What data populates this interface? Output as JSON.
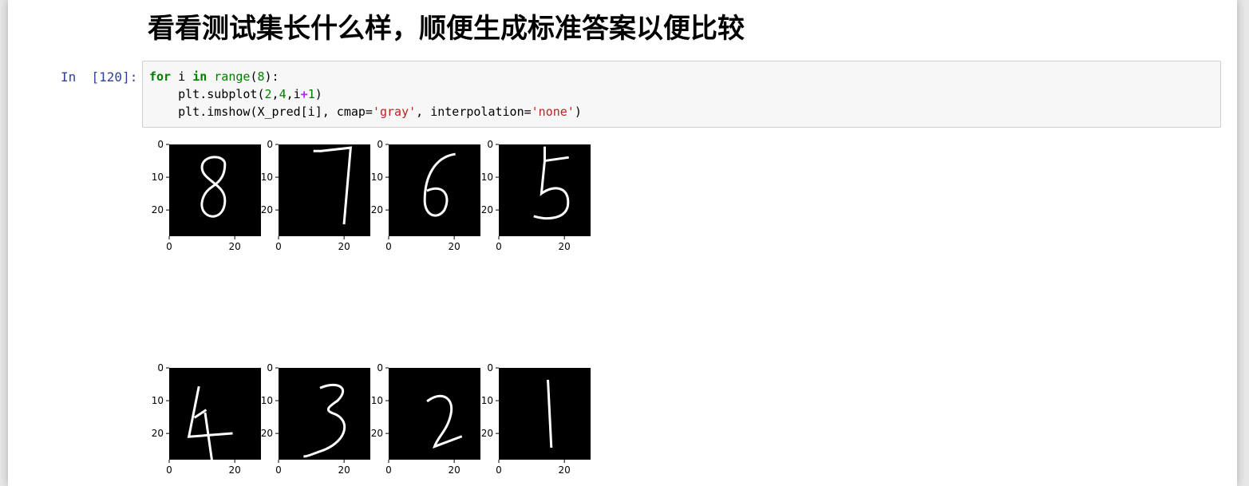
{
  "heading": "看看测试集长什么样，顺便生成标准答案以便比较",
  "cell": {
    "prompt": "In  [120]:",
    "code": [
      [
        [
          "kw",
          "for"
        ],
        [
          "p",
          " i "
        ],
        [
          "kw",
          "in"
        ],
        [
          "p",
          " "
        ],
        [
          "bi",
          "range"
        ],
        [
          "p",
          "("
        ],
        [
          "nm",
          "8"
        ],
        [
          "p",
          "):"
        ]
      ],
      [
        [
          "p",
          "    plt.subplot("
        ],
        [
          "nm",
          "2"
        ],
        [
          "p",
          ","
        ],
        [
          "nm",
          "4"
        ],
        [
          "p",
          ",i"
        ],
        [
          "op",
          "+"
        ],
        [
          "nm",
          "1"
        ],
        [
          "p",
          ")"
        ]
      ],
      [
        [
          "p",
          "    plt.imshow(X_pred[i], cmap="
        ],
        [
          "st",
          "'gray'"
        ],
        [
          "p",
          ", interpolation="
        ],
        [
          "st",
          "'none'"
        ],
        [
          "p",
          ")"
        ]
      ]
    ]
  },
  "chart_data": {
    "type": "image-grid",
    "layout": {
      "rows": 2,
      "cols": 4
    },
    "cmap": "gray",
    "interpolation": "none",
    "subplots": [
      {
        "digit": "8",
        "xticks": [
          "0",
          "20"
        ],
        "yticks": [
          "0",
          "10",
          "20"
        ],
        "xlim": [
          0,
          28
        ],
        "ylim": [
          28,
          0
        ]
      },
      {
        "digit": "7",
        "xticks": [
          "0",
          "20"
        ],
        "yticks": [
          "0",
          "10",
          "20"
        ],
        "xlim": [
          0,
          28
        ],
        "ylim": [
          28,
          0
        ]
      },
      {
        "digit": "6",
        "xticks": [
          "0",
          "20"
        ],
        "yticks": [
          "0",
          "10",
          "20"
        ],
        "xlim": [
          0,
          28
        ],
        "ylim": [
          28,
          0
        ]
      },
      {
        "digit": "5",
        "xticks": [
          "0",
          "20"
        ],
        "yticks": [
          "0",
          "10",
          "20"
        ],
        "xlim": [
          0,
          28
        ],
        "ylim": [
          28,
          0
        ]
      },
      {
        "digit": "4",
        "xticks": [
          "0",
          "20"
        ],
        "yticks": [
          "0",
          "10",
          "20"
        ],
        "xlim": [
          0,
          28
        ],
        "ylim": [
          28,
          0
        ]
      },
      {
        "digit": "3",
        "xticks": [
          "0",
          "20"
        ],
        "yticks": [
          "0",
          "10",
          "20"
        ],
        "xlim": [
          0,
          28
        ],
        "ylim": [
          28,
          0
        ]
      },
      {
        "digit": "2",
        "xticks": [
          "0",
          "20"
        ],
        "yticks": [
          "0",
          "10",
          "20"
        ],
        "xlim": [
          0,
          28
        ],
        "ylim": [
          28,
          0
        ]
      },
      {
        "digit": "1",
        "xticks": [
          "0",
          "20"
        ],
        "yticks": [
          "0",
          "10",
          "20"
        ],
        "xlim": [
          0,
          28
        ],
        "ylim": [
          28,
          0
        ]
      }
    ]
  }
}
